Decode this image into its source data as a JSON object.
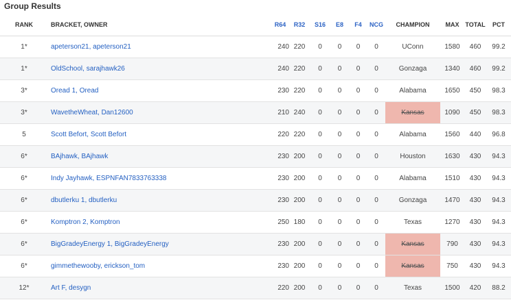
{
  "title": "Group Results",
  "columns": {
    "rank": "RANK",
    "bracket": "BRACKET, OWNER",
    "r64": "R64",
    "r32": "R32",
    "s16": "S16",
    "e8": "E8",
    "f4": "F4",
    "ncg": "NCG",
    "champion": "CHAMPION",
    "max": "MAX",
    "total": "TOTAL",
    "pct": "PCT"
  },
  "rows": [
    {
      "rank": "1*",
      "bracket": "apeterson21",
      "owner": "apeterson21",
      "r64": "240",
      "r32": "220",
      "s16": "0",
      "e8": "0",
      "f4": "0",
      "ncg": "0",
      "champion": "UConn",
      "champion_eliminated": false,
      "max": "1580",
      "total": "460",
      "pct": "99.2"
    },
    {
      "rank": "1*",
      "bracket": "OldSchool",
      "owner": "sarajhawk26",
      "r64": "240",
      "r32": "220",
      "s16": "0",
      "e8": "0",
      "f4": "0",
      "ncg": "0",
      "champion": "Gonzaga",
      "champion_eliminated": false,
      "max": "1340",
      "total": "460",
      "pct": "99.2"
    },
    {
      "rank": "3*",
      "bracket": "Oread 1",
      "owner": "Oread",
      "r64": "230",
      "r32": "220",
      "s16": "0",
      "e8": "0",
      "f4": "0",
      "ncg": "0",
      "champion": "Alabama",
      "champion_eliminated": false,
      "max": "1650",
      "total": "450",
      "pct": "98.3"
    },
    {
      "rank": "3*",
      "bracket": "WavetheWheat",
      "owner": "Dan12600",
      "r64": "210",
      "r32": "240",
      "s16": "0",
      "e8": "0",
      "f4": "0",
      "ncg": "0",
      "champion": "Kansas",
      "champion_eliminated": true,
      "max": "1090",
      "total": "450",
      "pct": "98.3"
    },
    {
      "rank": "5",
      "bracket": "Scott Befort",
      "owner": "Scott Befort",
      "r64": "220",
      "r32": "220",
      "s16": "0",
      "e8": "0",
      "f4": "0",
      "ncg": "0",
      "champion": "Alabama",
      "champion_eliminated": false,
      "max": "1560",
      "total": "440",
      "pct": "96.8"
    },
    {
      "rank": "6*",
      "bracket": "BAjhawk",
      "owner": "BAjhawk",
      "r64": "230",
      "r32": "200",
      "s16": "0",
      "e8": "0",
      "f4": "0",
      "ncg": "0",
      "champion": "Houston",
      "champion_eliminated": false,
      "max": "1630",
      "total": "430",
      "pct": "94.3"
    },
    {
      "rank": "6*",
      "bracket": "Indy Jayhawk",
      "owner": "ESPNFAN7833763338",
      "r64": "230",
      "r32": "200",
      "s16": "0",
      "e8": "0",
      "f4": "0",
      "ncg": "0",
      "champion": "Alabama",
      "champion_eliminated": false,
      "max": "1510",
      "total": "430",
      "pct": "94.3"
    },
    {
      "rank": "6*",
      "bracket": "dbutlerku 1",
      "owner": "dbutlerku",
      "r64": "230",
      "r32": "200",
      "s16": "0",
      "e8": "0",
      "f4": "0",
      "ncg": "0",
      "champion": "Gonzaga",
      "champion_eliminated": false,
      "max": "1470",
      "total": "430",
      "pct": "94.3"
    },
    {
      "rank": "6*",
      "bracket": "Komptron 2",
      "owner": "Komptron",
      "r64": "250",
      "r32": "180",
      "s16": "0",
      "e8": "0",
      "f4": "0",
      "ncg": "0",
      "champion": "Texas",
      "champion_eliminated": false,
      "max": "1270",
      "total": "430",
      "pct": "94.3"
    },
    {
      "rank": "6*",
      "bracket": "BigGradeyEnergy 1",
      "owner": "BigGradeyEnergy",
      "r64": "230",
      "r32": "200",
      "s16": "0",
      "e8": "0",
      "f4": "0",
      "ncg": "0",
      "champion": "Kansas",
      "champion_eliminated": true,
      "max": "790",
      "total": "430",
      "pct": "94.3"
    },
    {
      "rank": "6*",
      "bracket": "gimmethewooby",
      "owner": "erickson_tom",
      "r64": "230",
      "r32": "200",
      "s16": "0",
      "e8": "0",
      "f4": "0",
      "ncg": "0",
      "champion": "Kansas",
      "champion_eliminated": true,
      "max": "750",
      "total": "430",
      "pct": "94.3"
    },
    {
      "rank": "12*",
      "bracket": "Art F",
      "owner": "desygn",
      "r64": "220",
      "r32": "200",
      "s16": "0",
      "e8": "0",
      "f4": "0",
      "ncg": "0",
      "champion": "Texas",
      "champion_eliminated": false,
      "max": "1500",
      "total": "420",
      "pct": "88.2"
    }
  ]
}
